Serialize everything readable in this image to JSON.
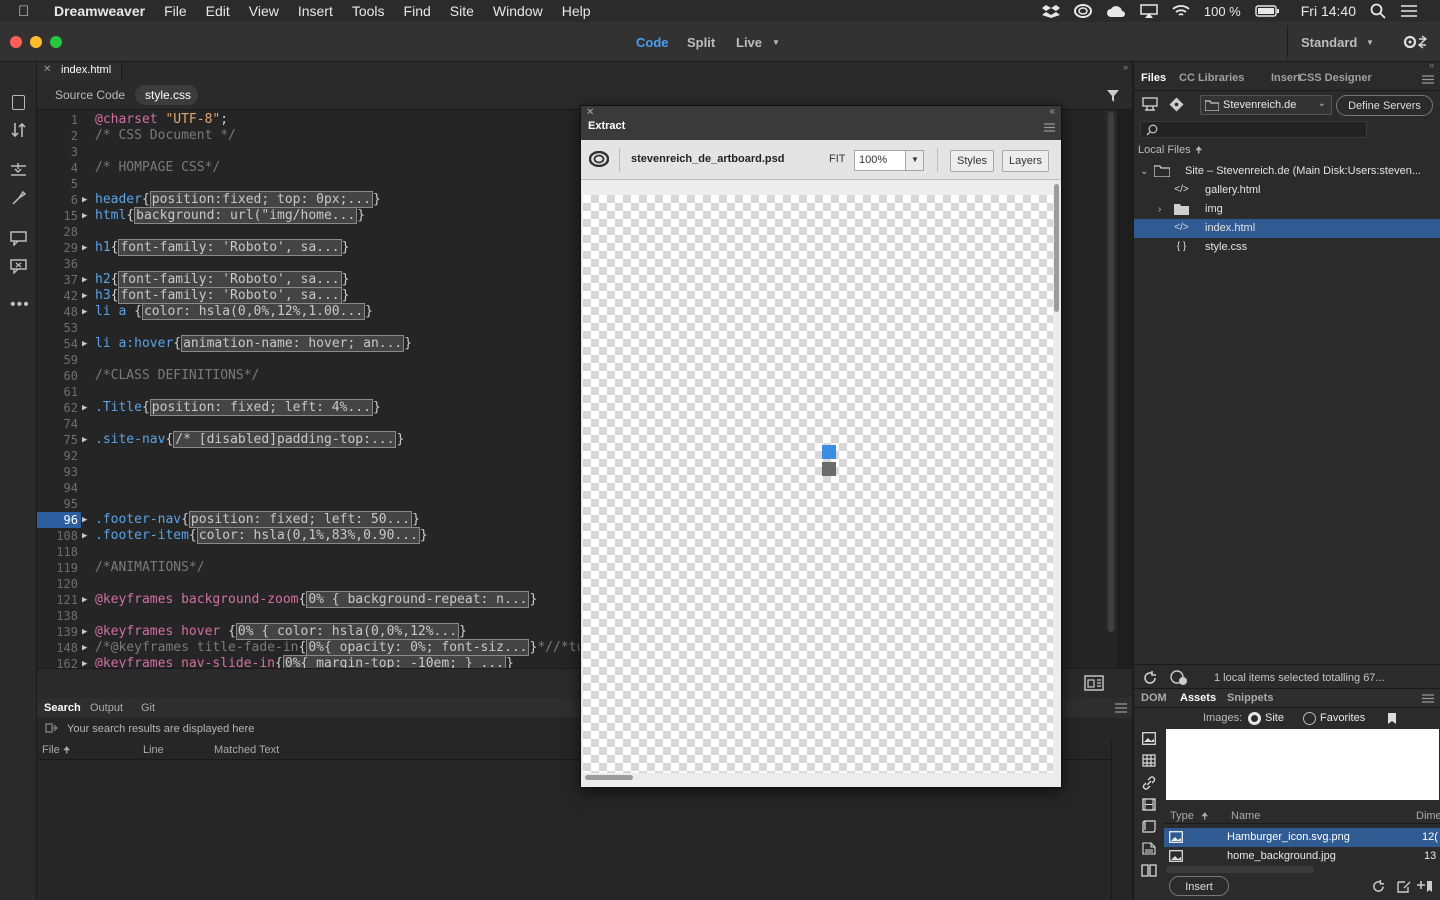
{
  "menubar": {
    "app": "Dreamweaver",
    "items": [
      "File",
      "Edit",
      "View",
      "Insert",
      "Tools",
      "Find",
      "Site",
      "Window",
      "Help"
    ],
    "battery": "100 %",
    "clock": "Fri 14:40"
  },
  "toolbar": {
    "view_code": "Code",
    "view_split": "Split",
    "view_live": "Live",
    "workspace": "Standard"
  },
  "document": {
    "tab": "index.html",
    "related": [
      "Source Code",
      "style.css"
    ]
  },
  "code_lines": [
    {
      "n": "1",
      "text": "@charset \"UTF-8\";"
    },
    {
      "n": "2",
      "text": "/* CSS Document */"
    },
    {
      "n": "3",
      "text": ""
    },
    {
      "n": "4",
      "text": "/* HOMPAGE CSS*/"
    },
    {
      "n": "5",
      "text": ""
    },
    {
      "n": "6",
      "sel": "header",
      "fold": "position:fixed; top: 0px;...",
      "tail": ""
    },
    {
      "n": "15",
      "sel": "html",
      "fold": "background: url(\"img/home...",
      "tail": ""
    },
    {
      "n": "28",
      "text": ""
    },
    {
      "n": "29",
      "sel": "h1",
      "fold": "font-family: 'Roboto', sa...",
      "tail": ""
    },
    {
      "n": "36",
      "text": ""
    },
    {
      "n": "37",
      "sel": "h2",
      "fold": "font-family: 'Roboto', sa...",
      "tail": ""
    },
    {
      "n": "42",
      "sel": "h3",
      "fold": "font-family: 'Roboto', sa...",
      "tail": ""
    },
    {
      "n": "48",
      "sel": "li a ",
      "fold": "color: hsla(0,0%,12%,1.00...",
      "tail": ""
    },
    {
      "n": "53",
      "text": ""
    },
    {
      "n": "54",
      "sel": "li a:hover",
      "fold": "animation-name: hover; an...",
      "tail": ""
    },
    {
      "n": "59",
      "text": ""
    },
    {
      "n": "60",
      "text": "/*CLASS DEFINITIONS*/"
    },
    {
      "n": "61",
      "text": ""
    },
    {
      "n": "62",
      "sel": ".Title",
      "fold": "position: fixed; left: 4%...",
      "tail": ""
    },
    {
      "n": "74",
      "text": ""
    },
    {
      "n": "75",
      "sel": ".site-nav",
      "fold": "/* [disabled]padding-top:...",
      "tail": ""
    },
    {
      "n": "92",
      "text": ""
    },
    {
      "n": "93",
      "text": ""
    },
    {
      "n": "94",
      "text": ""
    },
    {
      "n": "95",
      "text": ""
    },
    {
      "n": "96",
      "sel": ".footer-nav",
      "fold": "position: fixed; left: 50...",
      "tail": ""
    },
    {
      "n": "108",
      "sel": ".footer-item",
      "fold": "color: hsla(0,1%,83%,0.90...",
      "tail": ""
    },
    {
      "n": "118",
      "text": ""
    },
    {
      "n": "119",
      "text": "/*ANIMATIONS*/"
    },
    {
      "n": "120",
      "text": ""
    },
    {
      "n": "121",
      "sel": "@keyframes background-zoom",
      "fold": "0% { background-repeat: n...",
      "tail": ""
    },
    {
      "n": "138",
      "text": ""
    },
    {
      "n": "139",
      "sel": "@keyframes hover ",
      "fold": "0% { color: hsla(0,0%,12%...",
      "tail": ""
    },
    {
      "n": "148",
      "sel": "/*@keyframes title-fade-in",
      "fold": "0%{ opacity: 0%; font-siz...",
      "tail": "*//*tu"
    },
    {
      "n": "162",
      "sel": "@keyframes nav-slide-in",
      "fold": "0%{ margin-top: -10em; } ...",
      "tail": ""
    }
  ],
  "extract": {
    "title": "Extract",
    "file": "stevenreich_de_artboard.psd",
    "fit_label": "FIT",
    "zoom": "100%",
    "styles_btn": "Styles",
    "layers_btn": "Layers"
  },
  "bottom": {
    "tabs": [
      "Search",
      "Output",
      "Git"
    ],
    "message": "Your search results are displayed here",
    "columns": [
      "File",
      "Line",
      "Matched Text"
    ]
  },
  "files": {
    "tabs": [
      "Files",
      "CC Libraries",
      "Insert",
      "CSS Designer"
    ],
    "site": "Stevenreich.de",
    "define_servers": "Define Servers",
    "local_files": "Local Files",
    "tree": [
      {
        "label": "Site – Stevenreich.de (Main Disk:Users:steven...",
        "icon": "folder"
      },
      {
        "label": "gallery.html",
        "icon": "code"
      },
      {
        "label": "img",
        "icon": "folder"
      },
      {
        "label": "index.html",
        "icon": "code"
      },
      {
        "label": "style.css",
        "icon": "braces"
      }
    ],
    "status": "1 local items selected totalling 67..."
  },
  "assets": {
    "tabs": [
      "DOM",
      "Assets",
      "Snippets"
    ],
    "images_label": "Images:",
    "site_radio": "Site",
    "favorites_radio": "Favorites",
    "columns": [
      "Type",
      "Name",
      "Dime"
    ],
    "rows": [
      {
        "name": "Hamburger_icon.svg.png",
        "dim": "12("
      },
      {
        "name": "home_background.jpg",
        "dim": "13"
      }
    ],
    "insert_btn": "Insert"
  },
  "colors": {
    "accent": "#4a8fd6",
    "selection": "#2f5a92"
  }
}
